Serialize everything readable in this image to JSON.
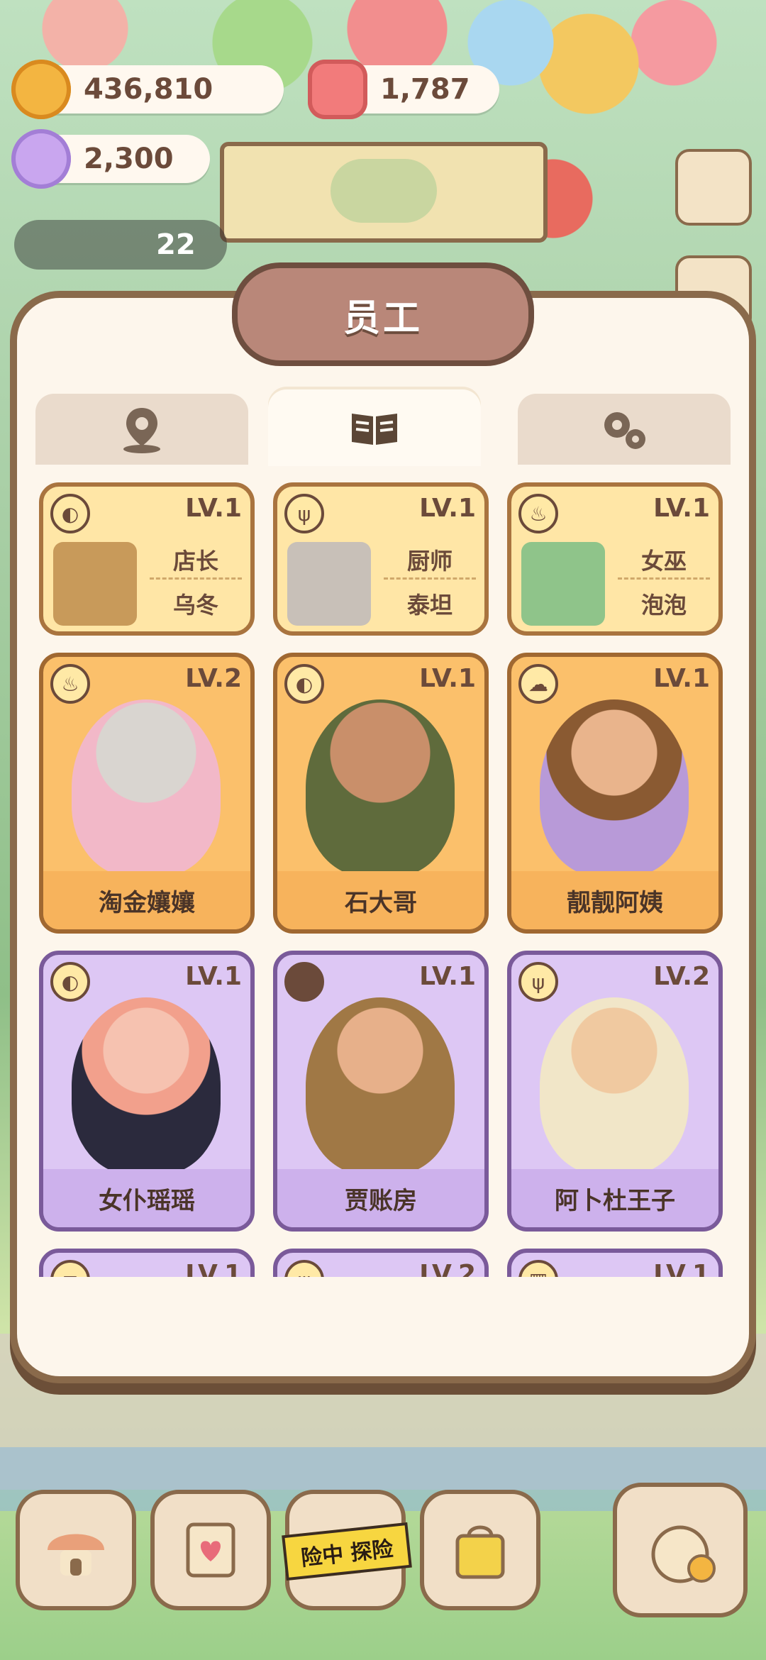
{
  "resources": {
    "coins": "436,810",
    "gems": "1,787",
    "candy": "2,300",
    "level_count": "22"
  },
  "panel": {
    "title": "员工",
    "tabs": [
      {
        "icon": "location-pin-icon",
        "active": false
      },
      {
        "icon": "open-book-icon",
        "active": true
      },
      {
        "icon": "gears-icon",
        "active": false
      }
    ]
  },
  "staff_small": [
    {
      "role": "店长",
      "name": "乌冬",
      "level": "LV.1",
      "badge": "bread-icon"
    },
    {
      "role": "厨师",
      "name": "泰坦",
      "level": "LV.1",
      "badge": "fork-spoon-icon"
    },
    {
      "role": "女巫",
      "name": "泡泡",
      "level": "LV.1",
      "badge": "steam-bowl-icon"
    }
  ],
  "staff_cards": [
    {
      "name": "淘金孃孃",
      "level": "LV.2",
      "badge": "steam-bowl-icon",
      "tier": "orange"
    },
    {
      "name": "石大哥",
      "level": "LV.1",
      "badge": "bread-icon",
      "tier": "orange"
    },
    {
      "name": "靓靓阿姨",
      "level": "LV.1",
      "badge": "cloud-icon",
      "tier": "orange"
    },
    {
      "name": "女仆瑶瑶",
      "level": "LV.1",
      "badge": "bread-icon",
      "tier": "purple"
    },
    {
      "name": "贾账房",
      "level": "LV.1",
      "badge": "dark-circle-icon",
      "tier": "purple"
    },
    {
      "name": "阿卜杜王子",
      "level": "LV.2",
      "badge": "fork-spoon-icon",
      "tier": "purple"
    }
  ],
  "partial_row_levels": [
    "LV.1",
    "LV.2",
    "LV.1"
  ],
  "bottom_nav": {
    "adventure_tape": "险中 探险"
  },
  "colors": {
    "panel_bg": "#fdf6ec",
    "card_orange": "#fbc06b",
    "card_purple": "#ddc7f4",
    "card_gold": "#ffe6a6"
  }
}
